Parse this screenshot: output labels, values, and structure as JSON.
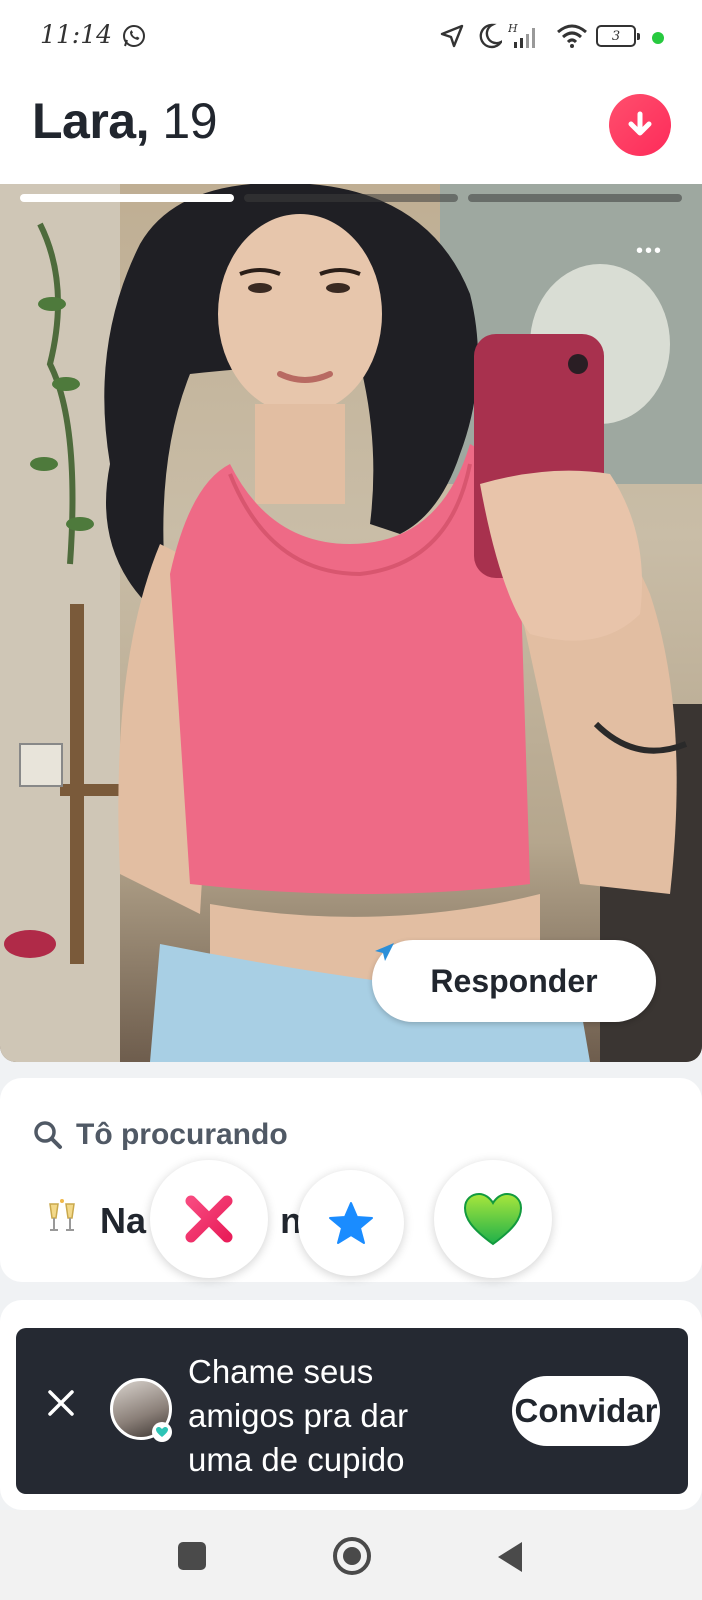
{
  "status_bar": {
    "time": "11:14",
    "battery": "3"
  },
  "header": {
    "name": "Lara,",
    "age": "19"
  },
  "photo": {
    "photo_count": 3,
    "active_index": 0
  },
  "reply": {
    "label": "Responder"
  },
  "looking_for": {
    "title": "Tô procurando",
    "value": "Na   ri   s   nde..."
  },
  "actions": {
    "nope": "x-icon",
    "super_like": "star-icon",
    "like": "heart-icon"
  },
  "snackbar": {
    "message": "Chame seus amigos pra dar uma de cupido",
    "invite_label": "Convidar"
  },
  "colors": {
    "brand": "#fd2b5a",
    "nope": "#f02e68",
    "super_like": "#1a8cff",
    "like": "#3cc83c",
    "snackbar": "#252932",
    "text_dark": "#21262e"
  }
}
